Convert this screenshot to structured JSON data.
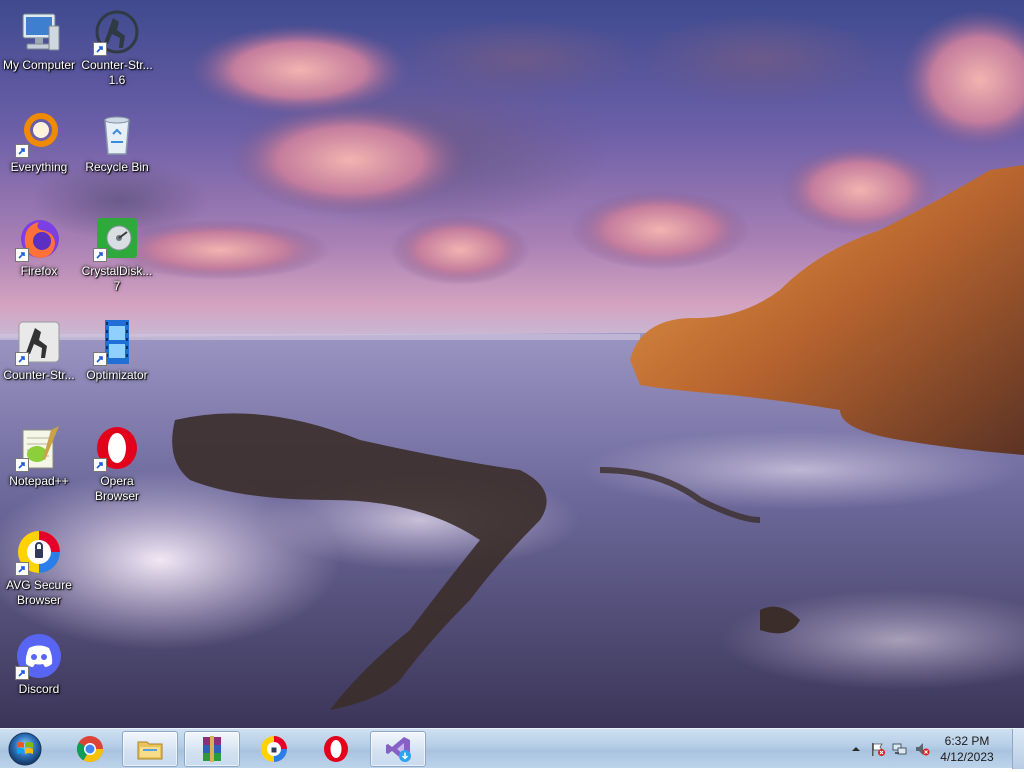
{
  "desktop": {
    "icons": [
      {
        "label": "My Computer"
      },
      {
        "label": "Counter-Str... 1.6"
      },
      {
        "label": "Everything"
      },
      {
        "label": "Recycle Bin"
      },
      {
        "label": "Firefox"
      },
      {
        "label": "CrystalDisk... 7"
      },
      {
        "label": "Counter-Str..."
      },
      {
        "label": "Optimizator"
      },
      {
        "label": "Notepad++"
      },
      {
        "label": "Opera Browser"
      },
      {
        "label": "AVG Secure Browser"
      },
      {
        "label": "Discord"
      }
    ]
  },
  "taskbar": {
    "start_icon": "windows-start-orb",
    "pinned": [
      {
        "icon": "chrome-icon"
      },
      {
        "icon": "file-explorer-icon"
      },
      {
        "icon": "winrar-icon"
      },
      {
        "icon": "avg-secure-browser-icon"
      },
      {
        "icon": "opera-icon"
      },
      {
        "icon": "visual-studio-installer-icon"
      }
    ],
    "tray": {
      "icons": [
        "show-hidden-icons-arrow",
        "action-center-flag-icon",
        "network-icon",
        "volume-muted-icon"
      ],
      "time": "6:32 PM",
      "date": "4/12/2023"
    }
  },
  "colors": {
    "taskbar": "#b4cde6",
    "opera_red": "#e3001b",
    "discord_blurple": "#5865f2",
    "firefox_orange": "#ff7139"
  }
}
